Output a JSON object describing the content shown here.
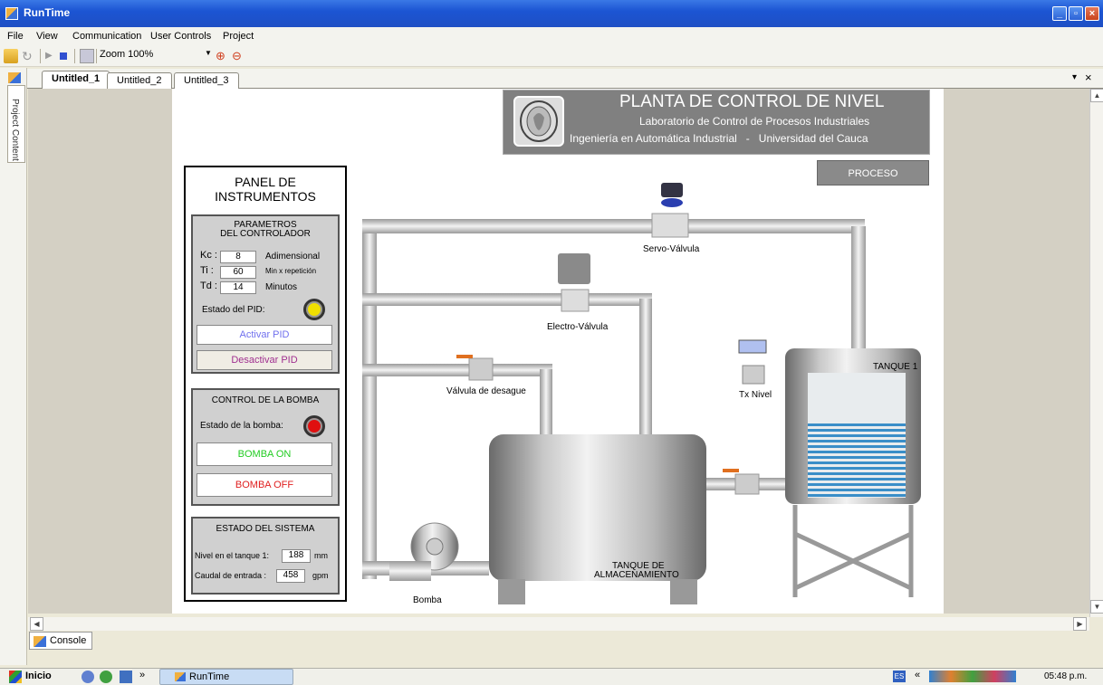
{
  "window": {
    "title": "RunTime"
  },
  "menu": [
    "File",
    "View",
    "Communication",
    "User Controls",
    "Project"
  ],
  "toolbar": {
    "zoom": "Zoom 100%"
  },
  "side_panel": {
    "label": "Project Content"
  },
  "tabs": [
    "Untitled_1",
    "Untitled_2",
    "Untitled_3"
  ],
  "banner": {
    "title": "PLANTA DE CONTROL DE NIVEL",
    "line1": "Laboratorio de Control de Procesos Industriales",
    "line2": "Ingeniería en Automática Industrial   -   Universidad del Cauca"
  },
  "proceso_button": "PROCESO",
  "panel": {
    "title_line1": "PANEL DE",
    "title_line2": "INSTRUMENTOS",
    "controller": {
      "title_line1": "PARAMETROS",
      "title_line2": "DEL CONTROLADOR",
      "kc_label": "Kc :",
      "kc_value": "8",
      "kc_unit": "Adimensional",
      "ti_label": "Ti :",
      "ti_value": "60",
      "ti_unit": "Min x repetición",
      "td_label": "Td :",
      "td_value": "14",
      "td_unit": "Minutos",
      "pid_state_label": "Estado del PID:",
      "activate": "Activar PID",
      "deactivate": "Desactivar PID"
    },
    "pump": {
      "title": "CONTROL DE LA BOMBA",
      "state_label": "Estado de la bomba:",
      "on": "BOMBA ON",
      "off": "BOMBA OFF"
    },
    "system": {
      "title": "ESTADO DEL SISTEMA",
      "level_label": "Nivel en el tanque 1:",
      "level_value": "188",
      "level_unit": "mm",
      "flow_label": "Caudal de entrada :",
      "flow_value": "458",
      "flow_unit": "gpm"
    }
  },
  "process": {
    "servo": "Servo-Válvula",
    "electro": "Electro-Válvula",
    "drain": "Válvula de desague",
    "tx": "Tx Nivel",
    "tank1": "TANQUE 1",
    "storage_line1": "TANQUE DE",
    "storage_line2": "ALMACENAMIENTO",
    "pump": "Bomba"
  },
  "console": {
    "label": "Console"
  },
  "taskbar": {
    "start": "Inicio",
    "app": "RunTime",
    "lang": "ES",
    "time": "05:48 p.m."
  },
  "colors": {
    "pid_led": "#f0e000",
    "pump_led": "#e01010",
    "activate_text": "#7070ee",
    "deactivate_text": "#a03090",
    "on_text": "#22cc22",
    "off_text": "#e02020",
    "water": "#3a8ec8"
  }
}
